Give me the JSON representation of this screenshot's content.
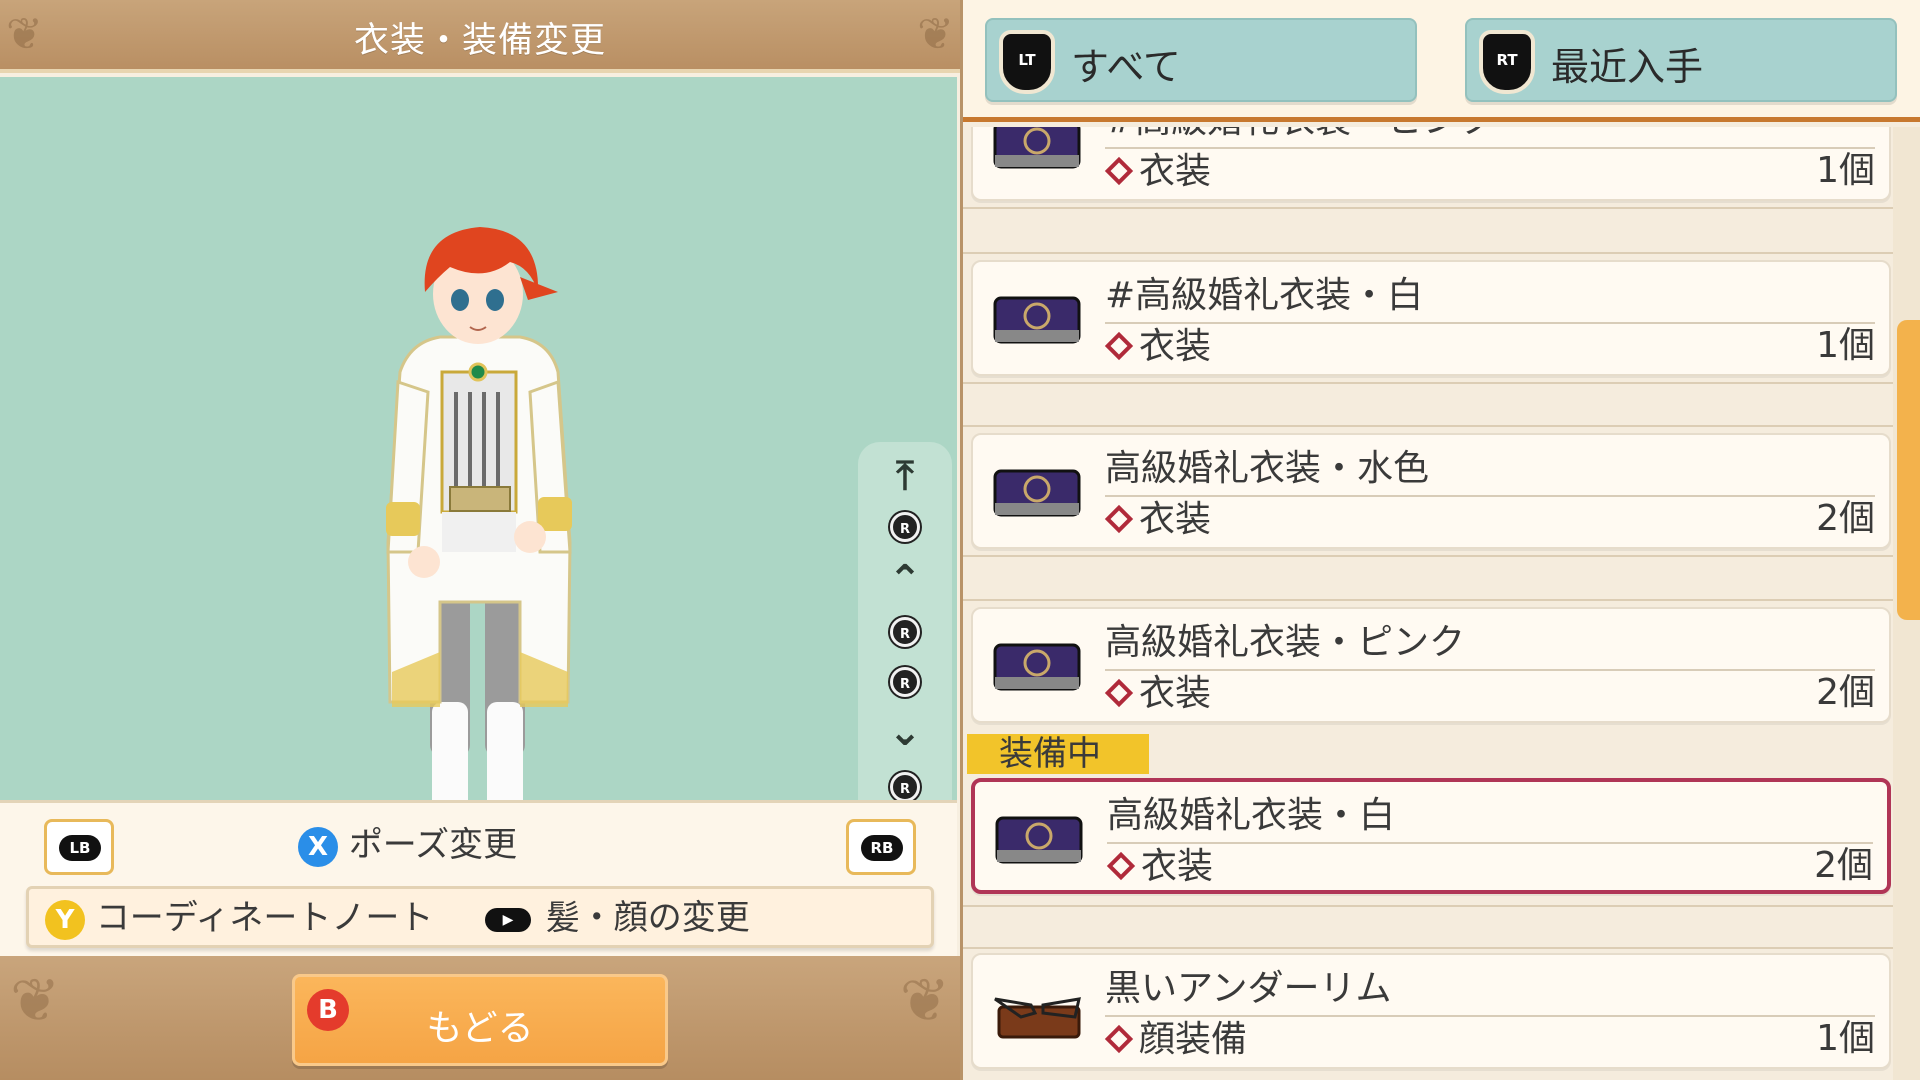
{
  "header": {
    "title": "衣装・装備変更"
  },
  "controls": {
    "lb_label": "LB",
    "rb_label": "RB",
    "x_button": "X",
    "pose_change": "ポーズ変更",
    "y_button": "Y",
    "coordinate_note": "コーディネートノート",
    "hair_face_change": "髪・顔の変更",
    "b_button": "B",
    "back": "もどる"
  },
  "camera_controls": {
    "r_label": "R"
  },
  "tabs": [
    {
      "trigger": "LT",
      "label": "すべて"
    },
    {
      "trigger": "RT",
      "label": "最近入手"
    }
  ],
  "equipped_badge": "装備中",
  "items": [
    {
      "name": "#高級婚礼衣装・ピンク",
      "category": "衣装",
      "qty": "1個",
      "icon": "purple-costume-case-icon",
      "equipped": false
    },
    {
      "name": "#高級婚礼衣装・白",
      "category": "衣装",
      "qty": "1個",
      "icon": "purple-costume-case-icon",
      "equipped": false
    },
    {
      "name": "高級婚礼衣装・水色",
      "category": "衣装",
      "qty": "2個",
      "icon": "purple-costume-case-icon",
      "equipped": false
    },
    {
      "name": "高級婚礼衣装・ピンク",
      "category": "衣装",
      "qty": "2個",
      "icon": "purple-costume-case-icon",
      "equipped": false
    },
    {
      "name": "高級婚礼衣装・白",
      "category": "衣装",
      "qty": "2個",
      "icon": "purple-costume-case-icon",
      "equipped": true
    },
    {
      "name": "黒いアンダーリム",
      "category": "顔装備",
      "qty": "1個",
      "icon": "glasses-case-icon",
      "equipped": false
    }
  ],
  "colors": {
    "accent_orange": "#f5a445",
    "viewer_bg": "#acd6c5",
    "tab_bg": "#a8d2cf",
    "equipped_border": "#b03556",
    "equipped_badge": "#f2c42a"
  }
}
